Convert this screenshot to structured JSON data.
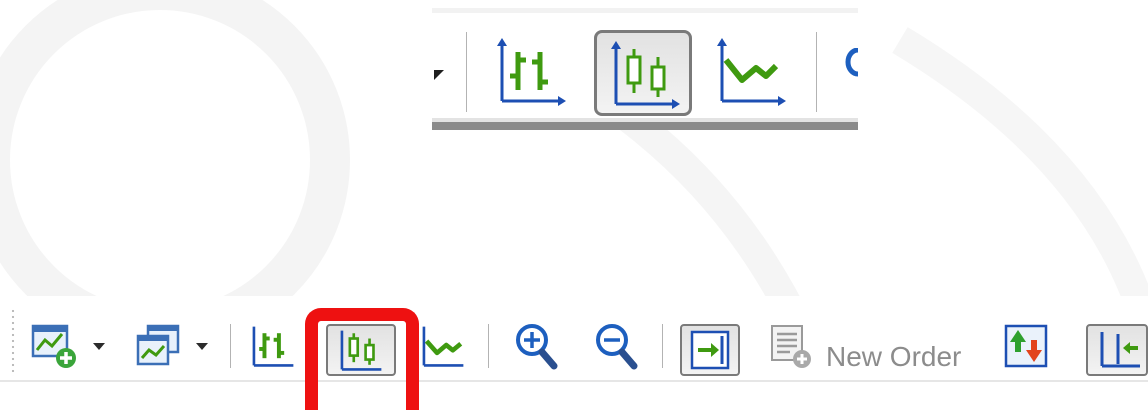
{
  "zoomed_toolbar": {
    "buttons": [
      {
        "icon": "bar-chart-icon",
        "state": "normal"
      },
      {
        "icon": "candlestick-chart-icon",
        "state": "pressed"
      },
      {
        "icon": "line-chart-icon",
        "state": "normal"
      }
    ]
  },
  "toolbar": {
    "new_order_label": "New Order",
    "buttons": [
      {
        "icon": "new-chart-icon",
        "has_dropdown": true
      },
      {
        "icon": "profiles-icon",
        "has_dropdown": true
      },
      {
        "icon": "bar-chart-icon",
        "state": "normal"
      },
      {
        "icon": "candlestick-chart-icon",
        "state": "pressed",
        "highlighted": true
      },
      {
        "icon": "line-chart-icon",
        "state": "normal"
      },
      {
        "icon": "zoom-in-icon",
        "state": "normal"
      },
      {
        "icon": "zoom-out-icon",
        "state": "normal"
      },
      {
        "icon": "auto-scroll-icon",
        "state": "pressed"
      },
      {
        "icon": "new-order-icon",
        "state": "disabled"
      },
      {
        "icon": "autotrading-icon",
        "state": "normal"
      },
      {
        "icon": "chart-shift-icon",
        "state": "pressed"
      }
    ]
  },
  "colors": {
    "highlight": "#ee1111",
    "chart_green": "#3f9a10",
    "axis_blue": "#1d4fb3",
    "pressed_border": "#7a7a7a",
    "disabled_text": "#8c8c8c"
  }
}
